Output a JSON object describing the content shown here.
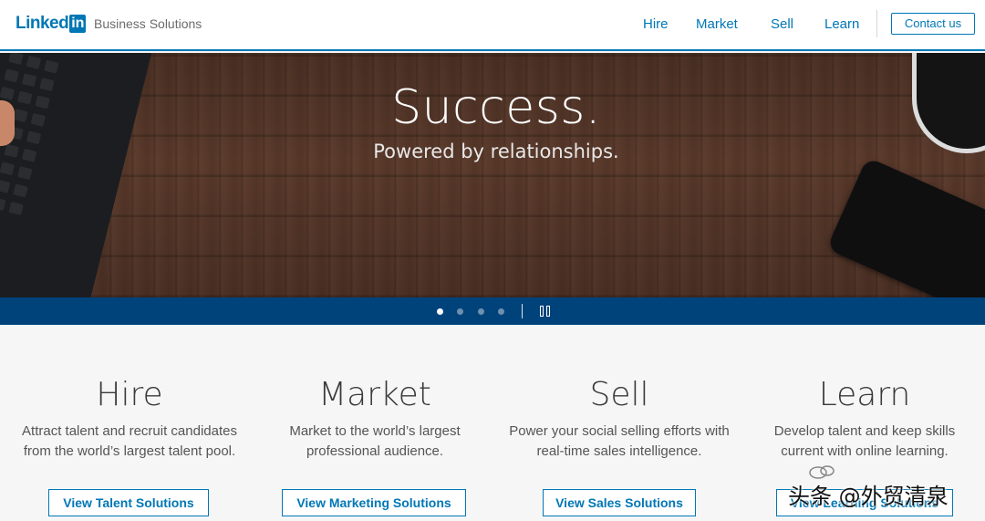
{
  "header": {
    "logo_text": "Linked",
    "logo_box": "in",
    "brand_sub": "Business Solutions",
    "nav": [
      "Hire",
      "Market",
      "Sell",
      "Learn"
    ],
    "contact_label": "Contact us"
  },
  "hero": {
    "title": "Success.",
    "subtitle": "Powered by relationships.",
    "slide_count": 4,
    "active_slide": 1
  },
  "columns": [
    {
      "title": "Hire",
      "desc_line1": "Attract talent and recruit candidates",
      "desc_line2": "from the world’s largest talent pool.",
      "cta": "View Talent Solutions"
    },
    {
      "title": "Market",
      "desc_line1": "Market to the world’s largest",
      "desc_line2": "professional audience.",
      "cta": "View Marketing Solutions"
    },
    {
      "title": "Sell",
      "desc_line1": "Power your social selling efforts with",
      "desc_line2": "real-time sales intelligence.",
      "cta": "View Sales Solutions"
    },
    {
      "title": "Learn",
      "desc_line1": "Develop talent and keep skills",
      "desc_line2": "current with online learning.",
      "cta": "View Learning Solutions"
    }
  ],
  "watermark": "头条 @外贸清泉",
  "colors": {
    "brand": "#0077b5",
    "carousel_bar": "#00437b",
    "page_bg": "#f6f6f6"
  }
}
